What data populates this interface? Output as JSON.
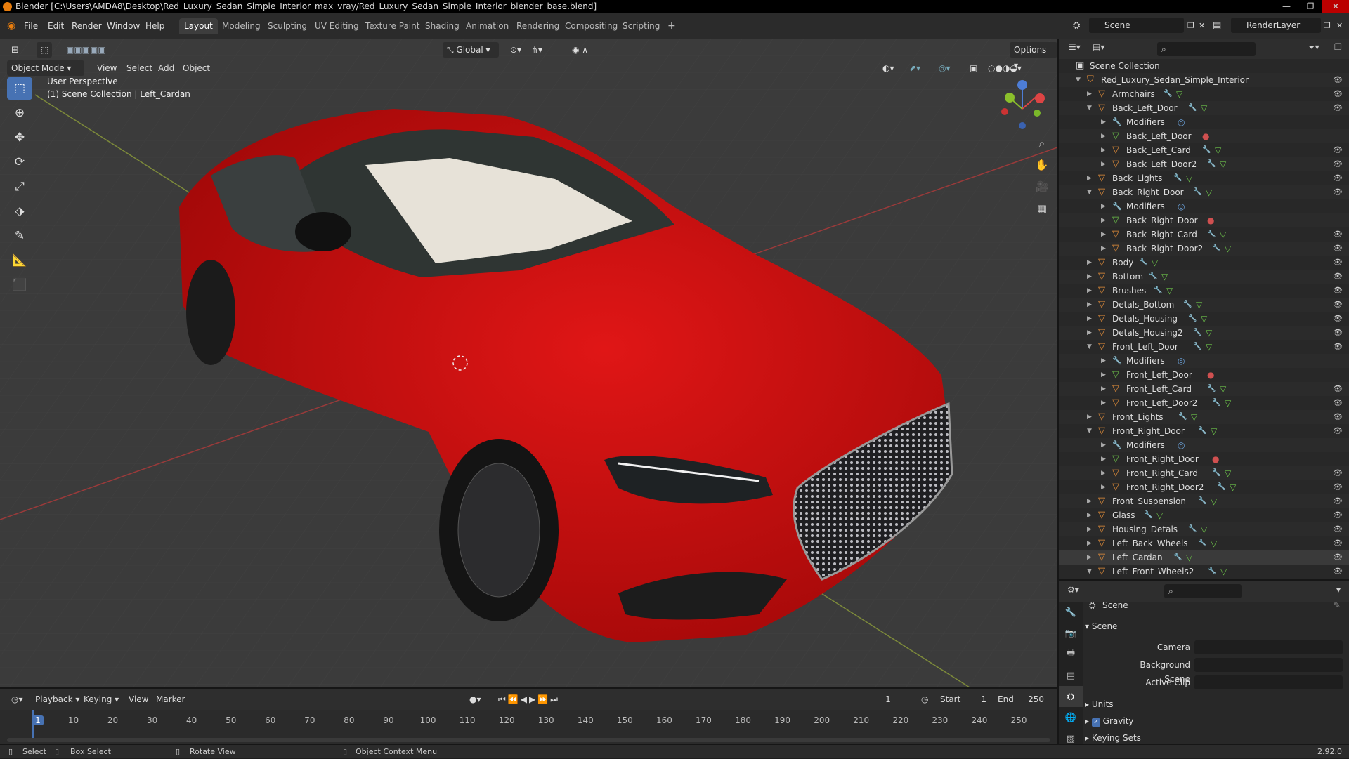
{
  "window": {
    "title": "Blender [C:\\Users\\AMDA8\\Desktop\\Red_Luxury_Sedan_Simple_Interior_max_vray/Red_Luxury_Sedan_Simple_Interior_blender_base.blend]"
  },
  "menu": [
    "File",
    "Edit",
    "Render",
    "Window",
    "Help"
  ],
  "workspaces": [
    "Layout",
    "Modeling",
    "Sculpting",
    "UV Editing",
    "Texture Paint",
    "Shading",
    "Animation",
    "Rendering",
    "Compositing",
    "Scripting"
  ],
  "scene": {
    "name": "Scene",
    "render_layer": "RenderLayer"
  },
  "viewport_header": {
    "mode": "Object Mode",
    "menus": [
      "View",
      "Select",
      "Add",
      "Object"
    ],
    "orientation": "Global",
    "options": "Options"
  },
  "viewport": {
    "perspective": "User Perspective",
    "collection_info": "(1) Scene Collection | Left_Cardan"
  },
  "outliner": {
    "root": "Scene Collection",
    "collection": "Red_Luxury_Sedan_Simple_Interior",
    "rows": [
      {
        "label": "Armchairs",
        "level": 0,
        "type": "obj",
        "expanded": false
      },
      {
        "label": "Back_Left_Door",
        "level": 0,
        "type": "obj",
        "expanded": true
      },
      {
        "label": "Modifiers",
        "level": 1,
        "type": "mod",
        "expanded": false
      },
      {
        "label": "Back_Left_Door",
        "level": 1,
        "type": "mesh",
        "expanded": false
      },
      {
        "label": "Back_Left_Card",
        "level": 1,
        "type": "obj",
        "expanded": false
      },
      {
        "label": "Back_Left_Door2",
        "level": 1,
        "type": "obj",
        "expanded": false
      },
      {
        "label": "Back_Lights",
        "level": 0,
        "type": "obj",
        "expanded": false
      },
      {
        "label": "Back_Right_Door",
        "level": 0,
        "type": "obj",
        "expanded": true
      },
      {
        "label": "Modifiers",
        "level": 1,
        "type": "mod",
        "expanded": false
      },
      {
        "label": "Back_Right_Door",
        "level": 1,
        "type": "mesh",
        "expanded": false
      },
      {
        "label": "Back_Right_Card",
        "level": 1,
        "type": "obj",
        "expanded": false
      },
      {
        "label": "Back_Right_Door2",
        "level": 1,
        "type": "obj",
        "expanded": false
      },
      {
        "label": "Body",
        "level": 0,
        "type": "obj",
        "expanded": false
      },
      {
        "label": "Bottom",
        "level": 0,
        "type": "obj",
        "expanded": false
      },
      {
        "label": "Brushes",
        "level": 0,
        "type": "obj",
        "expanded": false
      },
      {
        "label": "Detals_Bottom",
        "level": 0,
        "type": "obj",
        "expanded": false
      },
      {
        "label": "Detals_Housing",
        "level": 0,
        "type": "obj",
        "expanded": false
      },
      {
        "label": "Detals_Housing2",
        "level": 0,
        "type": "obj",
        "expanded": false
      },
      {
        "label": "Front_Left_Door",
        "level": 0,
        "type": "obj",
        "expanded": true
      },
      {
        "label": "Modifiers",
        "level": 1,
        "type": "mod",
        "expanded": false
      },
      {
        "label": "Front_Left_Door",
        "level": 1,
        "type": "mesh",
        "expanded": false
      },
      {
        "label": "Front_Left_Card",
        "level": 1,
        "type": "obj",
        "expanded": false
      },
      {
        "label": "Front_Left_Door2",
        "level": 1,
        "type": "obj",
        "expanded": false
      },
      {
        "label": "Front_Lights",
        "level": 0,
        "type": "obj",
        "expanded": false
      },
      {
        "label": "Front_Right_Door",
        "level": 0,
        "type": "obj",
        "expanded": true
      },
      {
        "label": "Modifiers",
        "level": 1,
        "type": "mod",
        "expanded": false
      },
      {
        "label": "Front_Right_Door",
        "level": 1,
        "type": "mesh",
        "expanded": false
      },
      {
        "label": "Front_Right_Card",
        "level": 1,
        "type": "obj",
        "expanded": false
      },
      {
        "label": "Front_Right_Door2",
        "level": 1,
        "type": "obj",
        "expanded": false
      },
      {
        "label": "Front_Suspension",
        "level": 0,
        "type": "obj",
        "expanded": false
      },
      {
        "label": "Glass",
        "level": 0,
        "type": "obj",
        "expanded": false
      },
      {
        "label": "Housing_Detals",
        "level": 0,
        "type": "obj",
        "expanded": false
      },
      {
        "label": "Left_Back_Wheels",
        "level": 0,
        "type": "obj",
        "expanded": false
      },
      {
        "label": "Left_Cardan",
        "level": 0,
        "type": "obj",
        "expanded": false,
        "selected": true
      },
      {
        "label": "Left_Front_Wheels2",
        "level": 0,
        "type": "obj",
        "expanded": true
      }
    ]
  },
  "properties": {
    "header": "Scene",
    "panel": "Scene",
    "fields": [
      {
        "label": "Camera"
      },
      {
        "label": "Background Scene"
      },
      {
        "label": "Active Clip"
      }
    ],
    "subpanels": [
      "Units",
      "Gravity",
      "Keying Sets"
    ]
  },
  "timeline": {
    "menus": [
      "Playback",
      "Keying",
      "View",
      "Marker"
    ],
    "current_frame": "1",
    "start_label": "Start",
    "start": "1",
    "end_label": "End",
    "end": "250",
    "ticks": [
      "1",
      "10",
      "20",
      "30",
      "40",
      "50",
      "60",
      "70",
      "80",
      "90",
      "100",
      "110",
      "120",
      "130",
      "140",
      "150",
      "160",
      "170",
      "180",
      "190",
      "200",
      "210",
      "220",
      "230",
      "240",
      "250"
    ]
  },
  "statusbar": {
    "select": "Select",
    "box_select": "Box Select",
    "rotate_view": "Rotate View",
    "context_menu": "Object Context Menu",
    "version": "2.92.0"
  },
  "colors": {
    "accent": "#4772b3",
    "car_red": "#d20a0a",
    "object_orange": "#e8903a",
    "mesh_green": "#6cc14a",
    "active_tab": "#3d3d3d"
  }
}
